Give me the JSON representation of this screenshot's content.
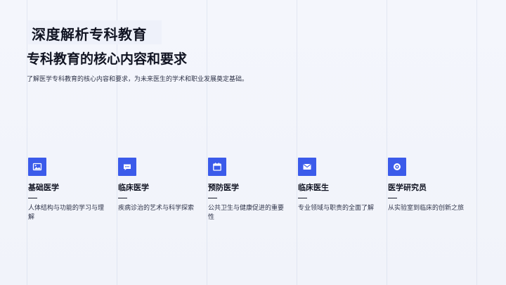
{
  "slide": {
    "title": "深度解析专科教育",
    "subtitle": "专科教育的核心内容和要求",
    "description": "了解医学专科教育的核心内容和要求，为未来医生的学术和职业发展奠定基础。"
  },
  "cards": [
    {
      "icon": "image-icon",
      "label": "基础医学",
      "text": "人体结构与功能的学习与理解"
    },
    {
      "icon": "chat-icon",
      "label": "临床医学",
      "text": "疾病诊治的艺术与科学探索"
    },
    {
      "icon": "calendar-icon",
      "label": "预防医学",
      "text": "公共卫生与健康促进的重要性"
    },
    {
      "icon": "mail-icon",
      "label": "临床医生",
      "text": "专业领域与职责的全面了解"
    },
    {
      "icon": "target-icon",
      "label": "医学研究员",
      "text": "从实验室到临床的创新之旅"
    }
  ],
  "colors": {
    "accent": "#3b5bea",
    "background": "#f3f5fb",
    "text": "#111422"
  }
}
